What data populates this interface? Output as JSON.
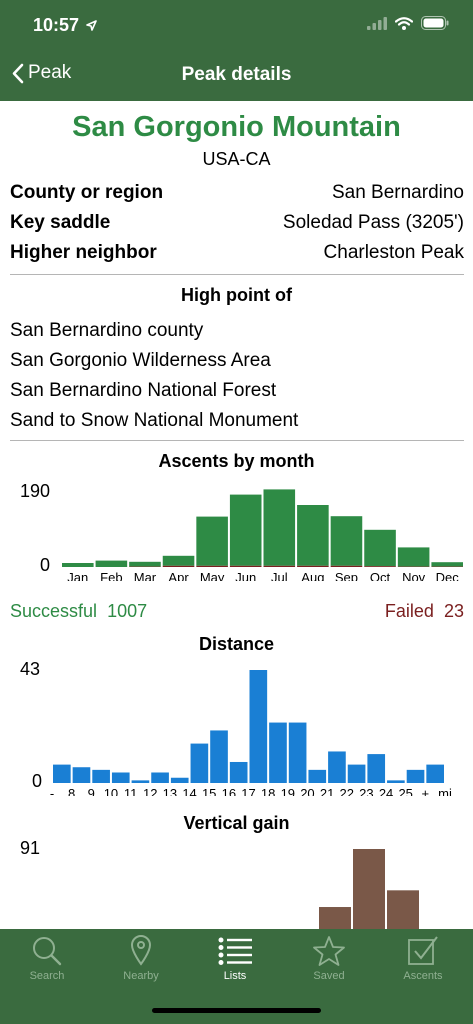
{
  "status_bar": {
    "time": "10:57"
  },
  "nav": {
    "back_label": "Peak",
    "title": "Peak details"
  },
  "peak": {
    "name": "San Gorgonio Mountain",
    "region": "USA-CA",
    "info": [
      {
        "key": "County or region",
        "value": "San Bernardino"
      },
      {
        "key": "Key saddle",
        "value": "Soledad Pass (3205')"
      },
      {
        "key": "Higher neighbor",
        "value": "Charleston Peak"
      }
    ]
  },
  "high_point": {
    "title": "High point of",
    "items": [
      "San Bernardino county",
      "San Gorgonio Wilderness Area",
      "San Bernardino National Forest",
      "Sand to Snow National Monument"
    ]
  },
  "legend": {
    "successful_label": "Successful",
    "successful_count": "1007",
    "failed_label": "Failed",
    "failed_count": "23"
  },
  "colors": {
    "header": "#3a6b3f",
    "success": "#2e8b45",
    "failed": "#7a1f1f",
    "distance": "#1a7fd4",
    "vertical": "#7a5848",
    "title": "#2e8b45"
  },
  "chart_data": [
    {
      "type": "bar",
      "title": "Ascents by month",
      "categories": [
        "Jan",
        "Feb",
        "Mar",
        "Apr",
        "May",
        "Jun",
        "Jul",
        "Aug",
        "Sep",
        "Oct",
        "Nov",
        "Dec"
      ],
      "series": [
        {
          "name": "Successful",
          "values": [
            10,
            16,
            12,
            25,
            123,
            178,
            191,
            152,
            124,
            91,
            48,
            11
          ]
        },
        {
          "name": "Failed",
          "values": [
            0,
            0,
            1,
            3,
            3,
            3,
            3,
            3,
            3,
            2,
            1,
            1
          ]
        }
      ],
      "ylim": [
        0,
        190
      ],
      "ytick_labels": [
        "190",
        "0"
      ]
    },
    {
      "type": "bar",
      "title": "Distance",
      "categories": [
        "-",
        "8",
        "9",
        "10",
        "11",
        "12",
        "13",
        "14",
        "15",
        "16",
        "17",
        "18",
        "19",
        "20",
        "21",
        "22",
        "23",
        "24",
        "25",
        "+",
        "mi"
      ],
      "values": [
        7,
        6,
        5,
        4,
        1,
        4,
        2,
        15,
        20,
        8,
        43,
        23,
        23,
        5,
        12,
        7,
        11,
        1,
        5,
        7
      ],
      "ylim": [
        0,
        43
      ],
      "ytick_labels": [
        "43",
        "0"
      ]
    },
    {
      "type": "bar",
      "title": "Vertical gain",
      "values": [
        25,
        91,
        44
      ],
      "ylim": [
        0,
        91
      ],
      "ytick_labels": [
        "91"
      ]
    }
  ],
  "tabs": [
    {
      "label": "Search",
      "icon": "search-icon"
    },
    {
      "label": "Nearby",
      "icon": "map-pin-icon"
    },
    {
      "label": "Lists",
      "icon": "list-icon"
    },
    {
      "label": "Saved",
      "icon": "star-icon"
    },
    {
      "label": "Ascents",
      "icon": "checkbox-icon"
    }
  ]
}
